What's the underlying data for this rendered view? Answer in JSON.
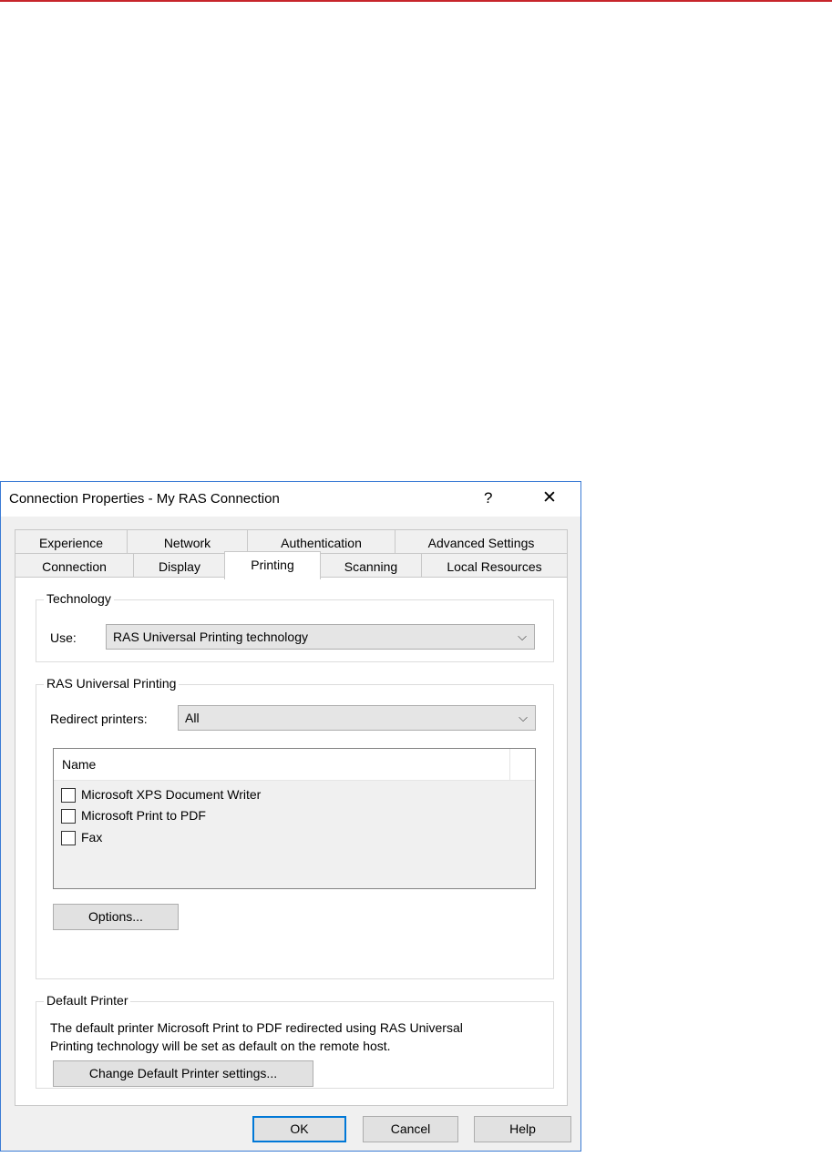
{
  "dialog": {
    "title": "Connection Properties - My RAS Connection",
    "help_glyph": "?",
    "close_glyph": "✕"
  },
  "tabs": {
    "row1": [
      "Experience",
      "Network",
      "Authentication",
      "Advanced Settings"
    ],
    "row2": [
      "Connection",
      "Display",
      "Printing",
      "Scanning",
      "Local Resources"
    ],
    "active": "Printing"
  },
  "technology": {
    "legend": "Technology",
    "use_label": "Use:",
    "selected": "RAS Universal Printing technology"
  },
  "universal": {
    "legend": "RAS Universal Printing",
    "redirect_label": "Redirect printers:",
    "redirect_selected": "All",
    "list_header": "Name",
    "printers": [
      {
        "name": "Microsoft XPS Document Writer",
        "checked": false
      },
      {
        "name": "Microsoft Print to PDF",
        "checked": false
      },
      {
        "name": "Fax",
        "checked": false
      }
    ],
    "options_button": "Options..."
  },
  "default_printer": {
    "legend": "Default Printer",
    "line1": "The default printer Microsoft Print to PDF redirected using RAS Universal",
    "line2": "Printing technology will be set as default on the remote host.",
    "change_button": "Change Default Printer settings..."
  },
  "footer": {
    "ok": "OK",
    "cancel": "Cancel",
    "help": "Help"
  },
  "colors": {
    "accent": "#0078d7",
    "top_line": "#c7252b",
    "dialog_border": "#3a7bd5"
  }
}
